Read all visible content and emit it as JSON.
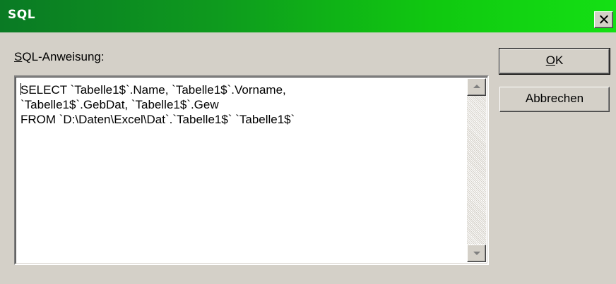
{
  "window": {
    "title": "SQL"
  },
  "form": {
    "label_mnemonic": "S",
    "label_rest": "QL-Anweisung:",
    "sql_lines": [
      "SELECT `Tabelle1$`.Name, `Tabelle1$`.Vorname,",
      "`Tabelle1$`.GebDat, `Tabelle1$`.Gew",
      "FROM `D:\\Daten\\Excel\\Dat`.`Tabelle1$` `Tabelle1$`"
    ]
  },
  "buttons": {
    "ok_mnemonic": "O",
    "ok_rest": "K",
    "cancel_label": "Abbrechen"
  },
  "colors": {
    "titlebar_start": "#0a7a24",
    "titlebar_end": "#14e014",
    "face": "#d4d0c8"
  },
  "icons": [
    "close-icon",
    "scroll-up-arrow-icon",
    "scroll-down-arrow-icon"
  ]
}
